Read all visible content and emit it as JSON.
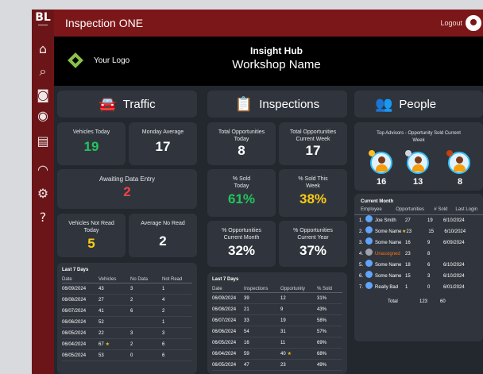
{
  "window": {
    "app_title": "Inspection ONE",
    "logout_label": "Logout"
  },
  "brand": {
    "logo_text": "Your Logo",
    "hub_title": "Insight Hub",
    "workshop_name": "Workshop Name",
    "accent": "#7c1719"
  },
  "sidebar": {
    "logo": "BL",
    "items": [
      {
        "icon": "home-icon"
      },
      {
        "icon": "car-search-icon"
      },
      {
        "icon": "camera-icon"
      },
      {
        "icon": "wheel-icon"
      },
      {
        "icon": "calculator-icon"
      },
      {
        "icon": "gauge-icon"
      },
      {
        "icon": "gear-icon"
      },
      {
        "icon": "help-icon"
      }
    ]
  },
  "traffic": {
    "header": "Traffic",
    "vehicles_today_label": "Vehicles Today",
    "vehicles_today": "19",
    "monday_avg_label": "Monday Average",
    "monday_avg": "17",
    "awaiting_label": "Awaiting Data Entry",
    "awaiting": "2",
    "not_read_label": "Vehicles Not Read Today",
    "not_read": "5",
    "avg_no_read_label": "Average No Read",
    "avg_no_read": "2",
    "last7": {
      "title": "Last 7 Days",
      "headers": [
        "Date",
        "Vehicles",
        "No Data",
        "Not Read"
      ],
      "rows": [
        [
          "06/09/2024",
          "43",
          "3",
          "1"
        ],
        [
          "06/08/2024",
          "27",
          "2",
          "4"
        ],
        [
          "06/07/2024",
          "41",
          "6",
          "2"
        ],
        [
          "06/06/2024",
          "52",
          "",
          "1"
        ],
        [
          "06/05/2024",
          "22",
          "3",
          "3"
        ],
        [
          "06/04/2024",
          "67",
          "2",
          "6"
        ],
        [
          "06/05/2024",
          "53",
          "0",
          "6"
        ]
      ]
    }
  },
  "inspections": {
    "header": "Inspections",
    "total_opp_today_label": "Total Opportunities Today",
    "total_opp_today": "8",
    "total_opp_week_label": "Total Opportunities Current Week",
    "total_opp_week": "17",
    "sold_today_label": "% Sold Today",
    "sold_today": "61%",
    "sold_week_label": "% Sold This Week",
    "sold_week": "38%",
    "opp_month_label": "% Opportunities Current Month",
    "opp_month": "32%",
    "opp_year_label": "% Opportunities Current Year",
    "opp_year": "37%",
    "last7": {
      "title": "Last 7 Days",
      "headers": [
        "Date",
        "Inspections",
        "Opportunity",
        "% Sold"
      ],
      "rows": [
        [
          "06/09/2024",
          "39",
          "12",
          "31%"
        ],
        [
          "06/08/2024",
          "21",
          "9",
          "43%"
        ],
        [
          "06/07/2024",
          "33",
          "19",
          "58%"
        ],
        [
          "06/06/2024",
          "54",
          "31",
          "57%"
        ],
        [
          "06/05/2024",
          "16",
          "11",
          "69%"
        ],
        [
          "06/04/2024",
          "59",
          "40",
          "68%"
        ],
        [
          "06/05/2024",
          "47",
          "23",
          "49%"
        ]
      ]
    }
  },
  "people": {
    "header": "People",
    "top_title": "Top Advisors - Opportunity Sold Current Week",
    "top_values": [
      "16",
      "13",
      "8"
    ],
    "current_month": {
      "title": "Current Month",
      "headers": [
        "Employee",
        "Opportunities",
        "# Sold",
        "Last Login"
      ],
      "rows": [
        [
          "1.",
          "Joe Smith",
          "27",
          "19",
          "6/10/2024"
        ],
        [
          "2.",
          "Some Name",
          "23",
          "15",
          "6/10/2024"
        ],
        [
          "3.",
          "Some Name",
          "16",
          "9",
          "6/09/2024"
        ],
        [
          "4.",
          "Unassigned",
          "23",
          "8",
          ""
        ],
        [
          "5.",
          "Some Name",
          "18",
          "6",
          "6/10/2024"
        ],
        [
          "6.",
          "Some Name",
          "15",
          "3",
          "6/10/2024"
        ],
        [
          "7.",
          "Really Bad",
          "1",
          "0",
          "6/01/2024"
        ]
      ],
      "total_label": "Total",
      "total_opp": "123",
      "total_sold": "60"
    }
  }
}
